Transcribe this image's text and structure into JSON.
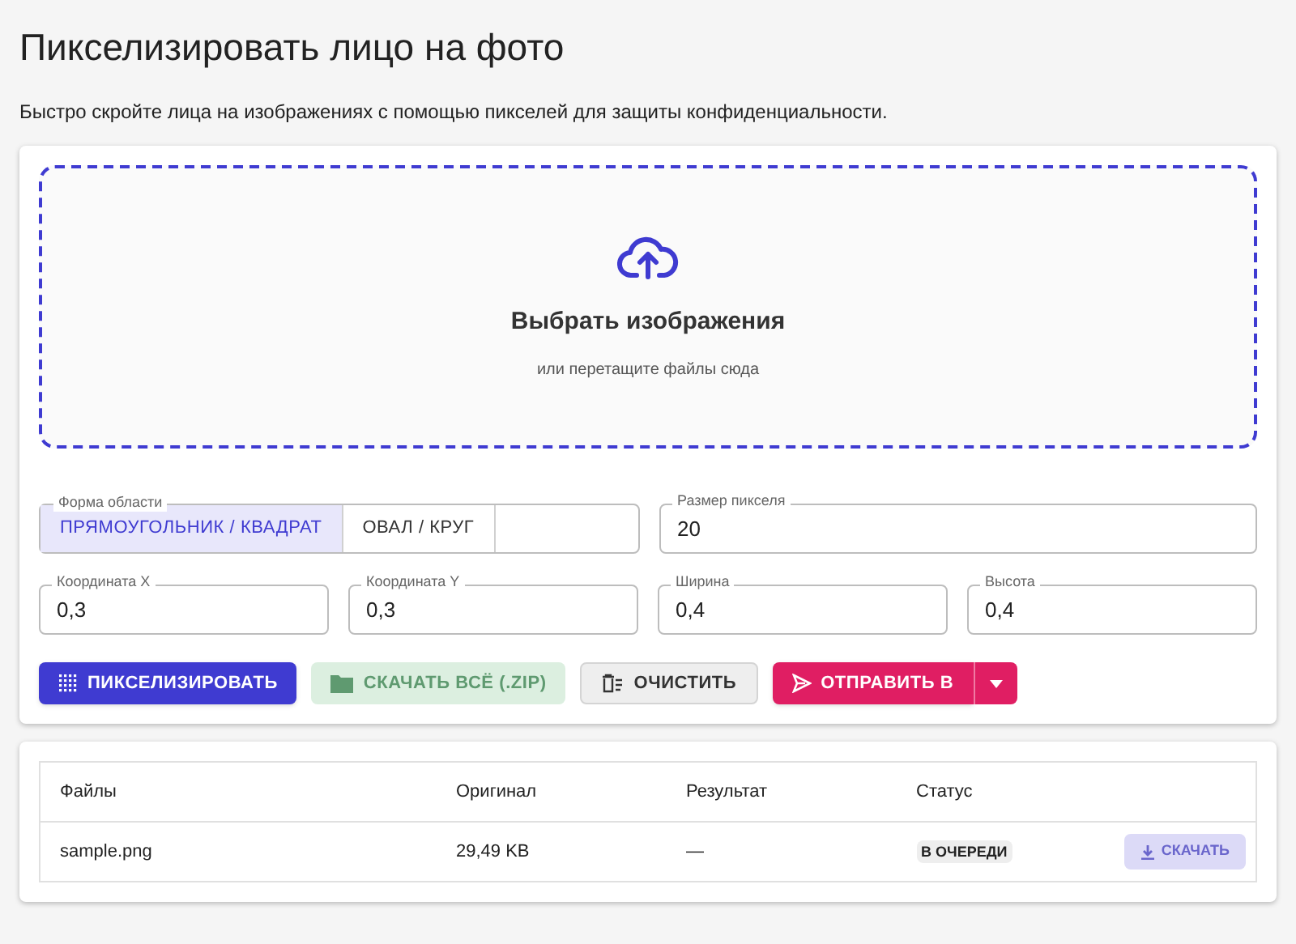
{
  "title": "Пикселизировать лицо на фото",
  "description": "Быстро скройте лица на изображениях с помощью пикселей для защиты конфиденциальности.",
  "dropzone": {
    "title": "Выбрать изображения",
    "hint": "или перетащите файлы сюда"
  },
  "shape": {
    "label": "Форма области",
    "options": [
      {
        "label": "ПРЯМОУГОЛЬНИК / КВАДРАТ",
        "selected": true
      },
      {
        "label": "ОВАЛ / КРУГ",
        "selected": false
      }
    ]
  },
  "pixel_size": {
    "label": "Размер пикселя",
    "value": "20"
  },
  "fields": [
    {
      "label": "Координата X",
      "value": "0,3"
    },
    {
      "label": "Координата Y",
      "value": "0,3"
    },
    {
      "label": "Ширина",
      "value": "0,4"
    },
    {
      "label": "Высота",
      "value": "0,4"
    }
  ],
  "buttons": [
    {
      "kind": "pixelate",
      "label": "ПИКСЕЛИЗИРОВАТЬ",
      "disabled": false
    },
    {
      "kind": "zip",
      "label": "СКАЧАТЬ ВСЁ (.ZIP)",
      "disabled": true
    },
    {
      "kind": "clear",
      "label": "ОЧИСТИТЬ",
      "disabled": false
    },
    {
      "kind": "send",
      "label": "ОТПРАВИТЬ В",
      "disabled": false
    }
  ],
  "table": {
    "columns": [
      "Файлы",
      "Оригинал",
      "Результат",
      "Статус"
    ],
    "rows": [
      {
        "file": "sample.png",
        "original": "29,49 KB",
        "result": "—",
        "status": "В ОЧЕРЕДИ",
        "action": {
          "label": "СКАЧАТЬ",
          "disabled": true
        }
      }
    ]
  }
}
